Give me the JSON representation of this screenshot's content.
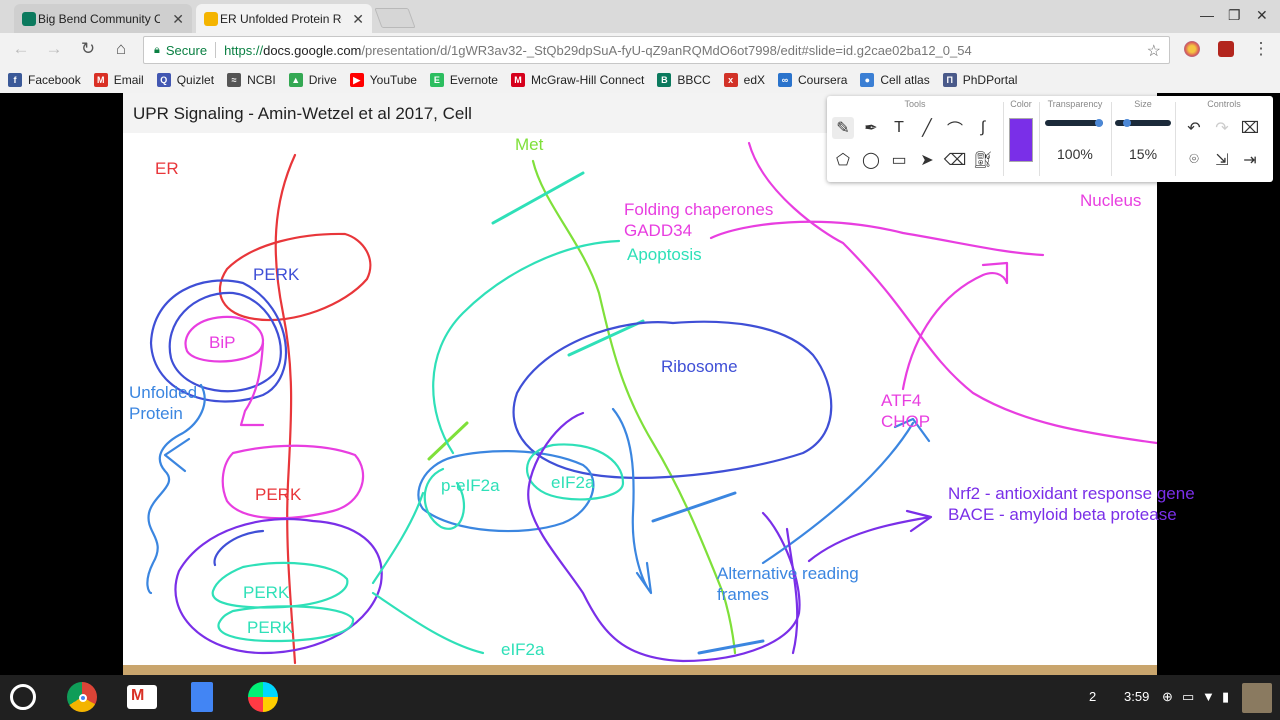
{
  "browser": {
    "tabs": [
      {
        "title": "Big Bend Community Co",
        "favicon_color": "#0b7a5e",
        "active": false
      },
      {
        "title": "ER Unfolded Protein Res",
        "favicon_color": "#f4b400",
        "active": true
      }
    ],
    "url": {
      "secure_label": "Secure",
      "scheme": "https://",
      "host": "docs.google.com",
      "path": "/presentation/d/1gWR3av32-_StQb29dpSuA-fyU-qZ9anRQMdO6ot7998/edit#slide=id.g2cae02ba12_0_54"
    },
    "bookmarks": [
      {
        "label": "Facebook",
        "icon": "facebook-icon",
        "color": "#3b5998",
        "glyph": "f"
      },
      {
        "label": "Email",
        "icon": "gmail-icon",
        "color": "#d93025",
        "glyph": "M"
      },
      {
        "label": "Quizlet",
        "icon": "quizlet-icon",
        "color": "#4257b2",
        "glyph": "Q"
      },
      {
        "label": "NCBI",
        "icon": "ncbi-icon",
        "color": "#555555",
        "glyph": "≈"
      },
      {
        "label": "Drive",
        "icon": "drive-icon",
        "color": "#34a853",
        "glyph": "▲"
      },
      {
        "label": "YouTube",
        "icon": "youtube-icon",
        "color": "#ff0000",
        "glyph": "▶"
      },
      {
        "label": "Evernote",
        "icon": "evernote-icon",
        "color": "#2dbe60",
        "glyph": "E"
      },
      {
        "label": "McGraw-Hill Connect",
        "icon": "mcgraw-hill-icon",
        "color": "#d6001c",
        "glyph": "M"
      },
      {
        "label": "BBCC",
        "icon": "bbcc-icon",
        "color": "#0b7a5e",
        "glyph": "B"
      },
      {
        "label": "edX",
        "icon": "edx-icon",
        "color": "#d23228",
        "glyph": "x"
      },
      {
        "label": "Coursera",
        "icon": "coursera-icon",
        "color": "#2a73cc",
        "glyph": "∞"
      },
      {
        "label": "Cell atlas",
        "icon": "cell-atlas-icon",
        "color": "#3b7fd4",
        "glyph": "●"
      },
      {
        "label": "PhDPortal",
        "icon": "phdportal-icon",
        "color": "#4a5a8a",
        "glyph": "Π"
      }
    ]
  },
  "slide": {
    "title": "UPR Signaling - Amin-Wetzel et al 2017, Cell",
    "labels": {
      "er": "ER",
      "perk_top": "PERK",
      "bip": "BiP",
      "unfolded_protein_1": "Unfolded",
      "unfolded_protein_2": "Protein",
      "perk_mid": "PERK",
      "perk_low_1": "PERK",
      "perk_low_2": "PERK",
      "met": "Met",
      "folding_chaperones": "Folding chaperones",
      "gadd34": "GADD34",
      "apoptosis": "Apoptosis",
      "ribosome": "Ribosome",
      "p_eif2a": "p-eIF2a",
      "eif2a_ribosome": "eIF2a",
      "eif2a_bottom": "eIF2a",
      "nucleus": "Nucleus",
      "atf4": "ATF4",
      "chop": "CHOP",
      "nrf2": "Nrf2 - antioxidant response gene",
      "bace": "BACE - amyloid beta protease",
      "alt_reading_1": "Alternative reading",
      "alt_reading_2": "frames"
    },
    "colors": {
      "red": "#e8363a",
      "blue": "#3f4fd6",
      "magenta": "#e83ee0",
      "sky": "#3b86e0",
      "teal": "#2fe0b8",
      "green": "#7fe03a",
      "violet": "#7a2fe8",
      "mint": "#55e0a0"
    }
  },
  "pen_tools": {
    "headers": {
      "tools": "Tools",
      "color": "Color",
      "transparency": "Transparency",
      "size": "Size",
      "controls": "Controls"
    },
    "color_value": "#7a2fe8",
    "transparency_value": "100%",
    "transparency_level": 1.0,
    "size_value": "15%",
    "size_level": 0.15
  },
  "shelf": {
    "badge": "2",
    "time": "3:59"
  }
}
